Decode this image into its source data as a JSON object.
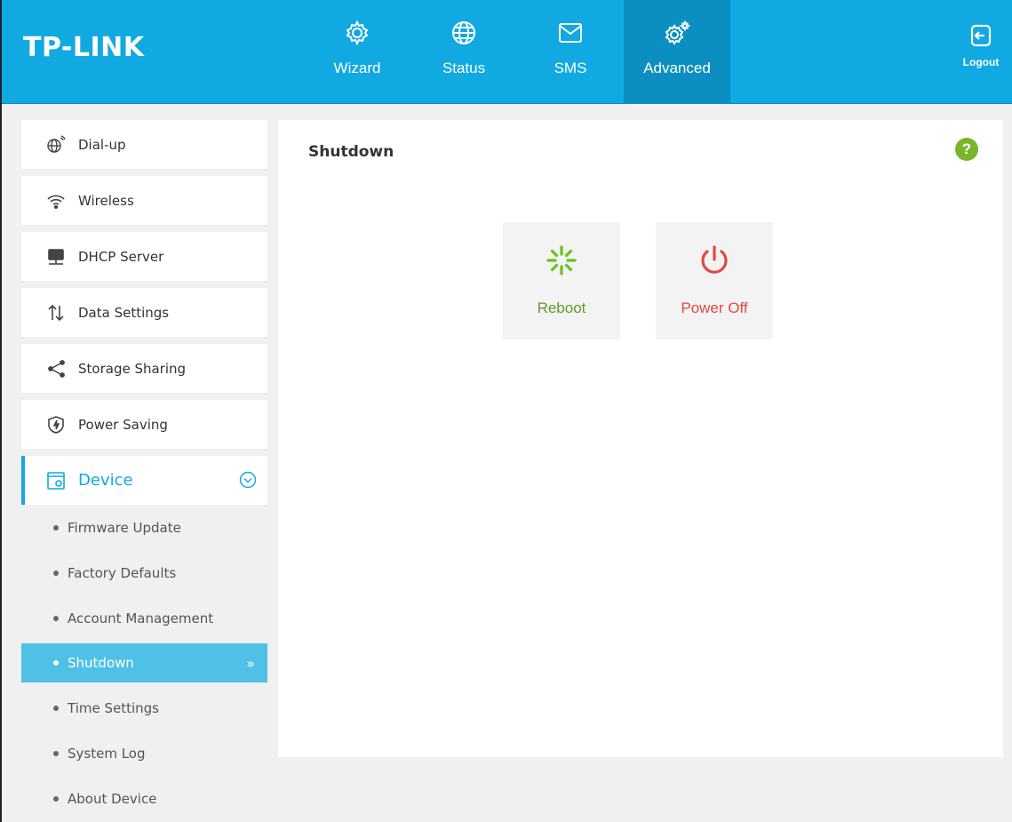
{
  "header": {
    "logo": "TP-LINK",
    "nav": [
      {
        "label": "Wizard",
        "icon": "gear-icon"
      },
      {
        "label": "Status",
        "icon": "globe-icon"
      },
      {
        "label": "SMS",
        "icon": "envelope-icon"
      },
      {
        "label": "Advanced",
        "icon": "gears-icon",
        "active": true
      }
    ],
    "logout_label": "Logout"
  },
  "sidebar": {
    "items": [
      {
        "label": "Dial-up",
        "icon": "globe-antenna-icon"
      },
      {
        "label": "Wireless",
        "icon": "wifi-icon"
      },
      {
        "label": "DHCP Server",
        "icon": "server-icon"
      },
      {
        "label": "Data Settings",
        "icon": "data-arrows-icon"
      },
      {
        "label": "Storage Sharing",
        "icon": "share-icon"
      },
      {
        "label": "Power Saving",
        "icon": "power-saving-icon"
      }
    ],
    "device": {
      "label": "Device",
      "subitems": [
        {
          "label": "Firmware Update"
        },
        {
          "label": "Factory Defaults"
        },
        {
          "label": "Account Management"
        },
        {
          "label": "Shutdown",
          "active": true
        },
        {
          "label": "Time Settings"
        },
        {
          "label": "System Log"
        },
        {
          "label": "About Device"
        }
      ]
    }
  },
  "main": {
    "title": "Shutdown",
    "help": "?",
    "reboot_label": "Reboot",
    "poweroff_label": "Power Off"
  },
  "colors": {
    "header": "#10a9e2",
    "header_active": "#0b8fc1",
    "sidebar_active": "#4fc1e6",
    "reboot": "#5e9b2a",
    "poweroff": "#e04a3f",
    "help": "#7ab52c"
  }
}
